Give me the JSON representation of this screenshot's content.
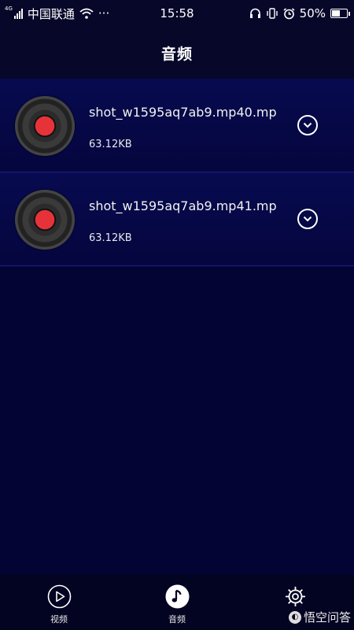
{
  "status_bar": {
    "network_tag": "4G",
    "carrier": "中国联通",
    "more": "···",
    "time": "15:58",
    "battery_percent": "50%",
    "battery_level": 0.5,
    "icons": [
      "signal-icon",
      "wifi-icon",
      "headphones-icon",
      "vibrate-icon",
      "alarm-icon",
      "battery-icon"
    ]
  },
  "header": {
    "title": "音频"
  },
  "audio_list": [
    {
      "name": "shot_w1595aq7ab9.mp40.mp",
      "size": "63.12KB",
      "icon": "vinyl-disc-icon",
      "action_icon": "chevron-down-circle-icon"
    },
    {
      "name": "shot_w1595aq7ab9.mp41.mp",
      "size": "63.12KB",
      "icon": "vinyl-disc-icon",
      "action_icon": "chevron-down-circle-icon"
    }
  ],
  "tabs": [
    {
      "label": "视频",
      "icon": "play-circle-icon",
      "active": false
    },
    {
      "label": "音频",
      "icon": "music-note-icon",
      "active": true
    },
    {
      "label": "",
      "icon": "gear-icon",
      "active": false
    }
  ],
  "watermark": {
    "text": "悟空问答"
  },
  "colors": {
    "background": "#040434",
    "row": "#070a4f",
    "divider": "#1a1f8c",
    "disc_center": "#e63339"
  }
}
